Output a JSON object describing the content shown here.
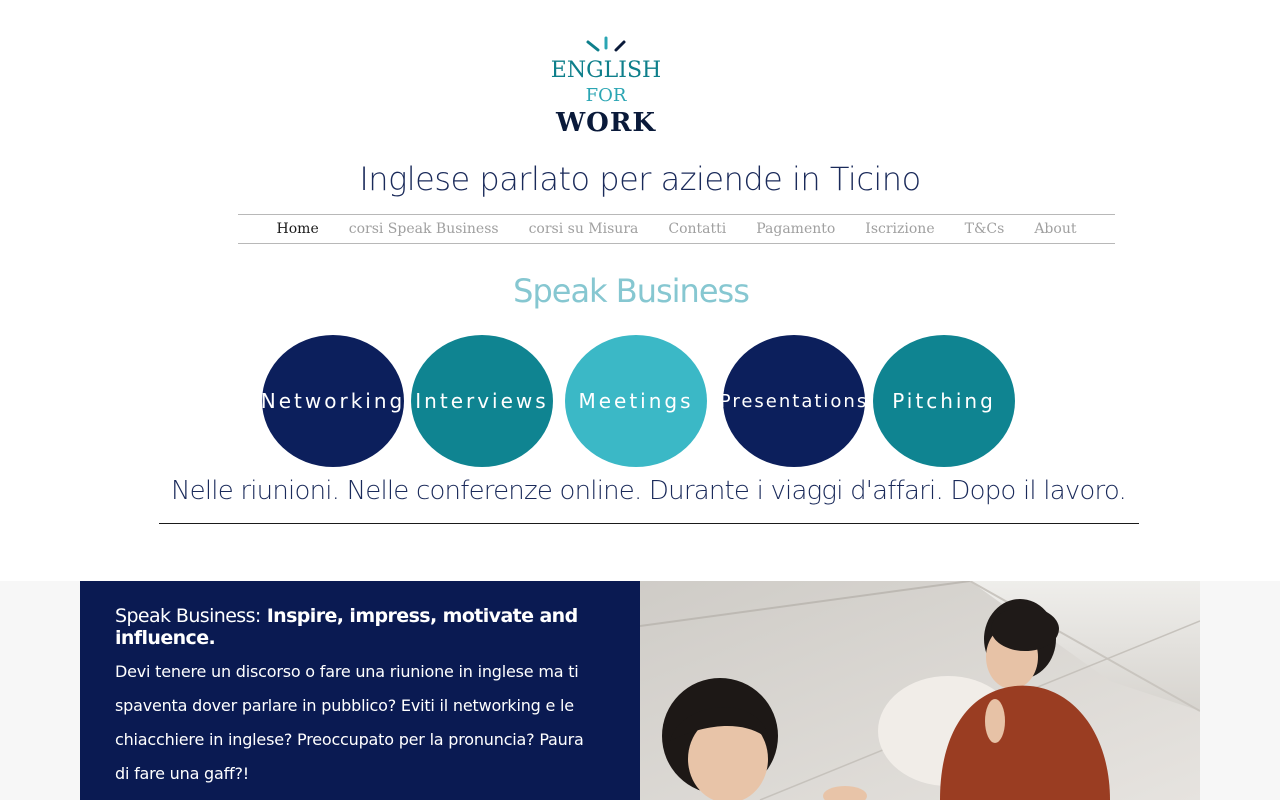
{
  "logo": {
    "line1": "ENGLISH",
    "line2": "FOR",
    "line3": "WORK",
    "colors": {
      "teal": "#0e7f8b",
      "light_teal": "#2aa5b3",
      "navy": "#0a1a3a"
    }
  },
  "header": {
    "tagline": "Inglese parlato per aziende in Ticino"
  },
  "nav": {
    "items": [
      {
        "label": "Home",
        "active": true
      },
      {
        "label": "corsi Speak Business",
        "active": false
      },
      {
        "label": "corsi su Misura",
        "active": false
      },
      {
        "label": "Contatti",
        "active": false
      },
      {
        "label": "Pagamento",
        "active": false
      },
      {
        "label": "Iscrizione",
        "active": false
      },
      {
        "label": "T&Cs",
        "active": false
      },
      {
        "label": "About",
        "active": false
      }
    ]
  },
  "main": {
    "section_title": "Speak Business",
    "circles": [
      {
        "label": "Networking",
        "color": "#0c1f5c"
      },
      {
        "label": "Interviews",
        "color": "#0f8491"
      },
      {
        "label": "Meetings",
        "color": "#3bb8c6"
      },
      {
        "label": "Presentations",
        "color": "#0c1f5c"
      },
      {
        "label": "Pitching",
        "color": "#0f8491"
      }
    ],
    "subline": "Nelle riunioni. Nelle conferenze online. Durante i viaggi d'affari. Dopo il lavoro."
  },
  "panel": {
    "heading_lead": "Speak Business:",
    "heading_rest": " Inspire, impress, motivate and influence.",
    "body": "Devi tenere un discorso o fare una riunione in inglese ma ti spaventa dover parlare in pubblico? Eviti il networking e le chiacchiere in inglese? Preoccupato per la pronuncia? Paura di fare una gaff?!",
    "background": "#0a1a52"
  }
}
